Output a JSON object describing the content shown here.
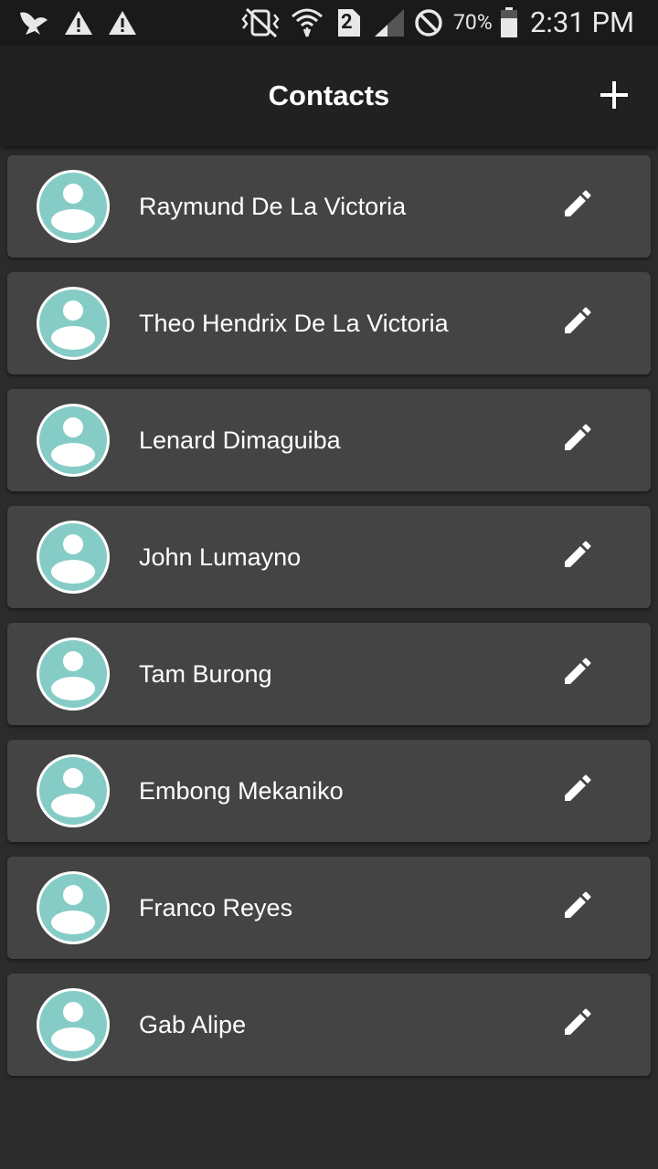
{
  "status_bar": {
    "battery": "70%",
    "time": "2:31 PM",
    "sim_slot": "2",
    "icons": [
      "bird-icon",
      "warning-icon",
      "warning-icon",
      "vibrate-icon",
      "wifi-icon",
      "sim-icon",
      "signal-icon",
      "no-disturb-icon",
      "battery-icon"
    ]
  },
  "appbar": {
    "title": "Contacts",
    "add_icon": "plus-icon"
  },
  "contacts": [
    {
      "name": "Raymund De La Victoria"
    },
    {
      "name": "Theo Hendrix De La Victoria"
    },
    {
      "name": "Lenard Dimaguiba"
    },
    {
      "name": "John Lumayno"
    },
    {
      "name": "Tam Burong"
    },
    {
      "name": "Embong Mekaniko"
    },
    {
      "name": "Franco Reyes"
    },
    {
      "name": "Gab Alipe"
    }
  ],
  "colors": {
    "background": "#2b2b2b",
    "card": "#444444",
    "appbar": "#212121",
    "avatar_accent": "#86ccc6"
  }
}
